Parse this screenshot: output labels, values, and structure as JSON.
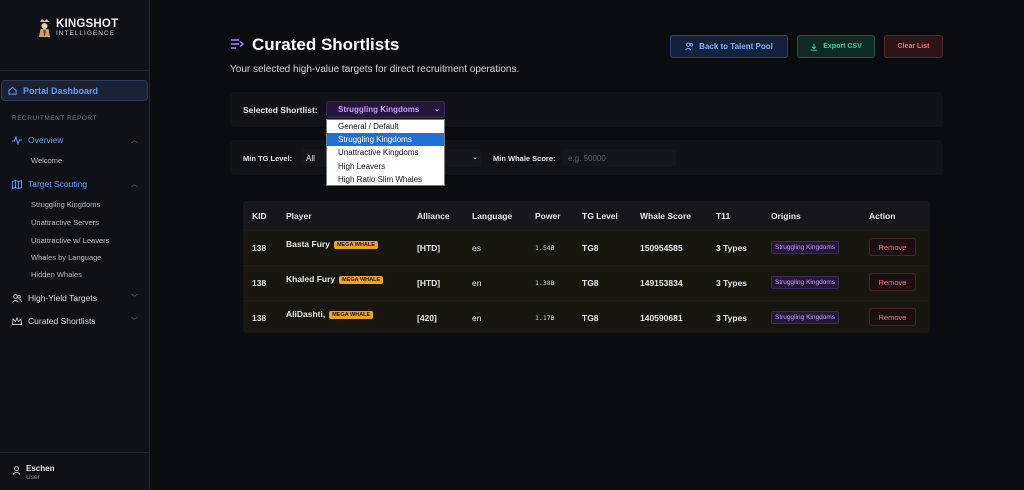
{
  "brand": {
    "title": "KINGSHOT",
    "subtitle": "INTELLIGENCE"
  },
  "sidebar": {
    "portal_label": "Portal Dashboard",
    "section_label": "RECRUITMENT REPORT",
    "overview": {
      "label": "Overview",
      "subitems": [
        "Welcome"
      ]
    },
    "target_scouting": {
      "label": "Target Scouting",
      "subitems": [
        "Struggling Kingdoms",
        "Unattractive Servers",
        "Unattractive w/ Leavers",
        "Whales by Language",
        "Hidden Whales"
      ]
    },
    "high_yield": {
      "label": "High-Yield Targets"
    },
    "curated": {
      "label": "Curated Shortlists"
    },
    "user": {
      "name": "Eschen",
      "role": "User"
    }
  },
  "header": {
    "title": "Curated Shortlists",
    "subtitle": "Your selected high-value targets for direct recruitment operations.",
    "back_label": "Back to Talent Pool",
    "export_label": "Export CSV",
    "clear_label": "Clear List"
  },
  "shortlist": {
    "label": "Selected Shortlist:",
    "selected": "Struggling Kingdoms",
    "options": [
      "General / Default",
      "Struggling Kingdoms",
      "Unattractive Kingdoms",
      "High Leavers",
      "High Ratio Slim Whales"
    ]
  },
  "filters": {
    "min_tg_label": "Min TG Level:",
    "min_tg_value": "All",
    "min_whale_label": "Min Whale Score:",
    "min_whale_placeholder": "e.g. 50000"
  },
  "table": {
    "headers": [
      "KID",
      "Player",
      "Alliance",
      "Language",
      "Power",
      "TG Level",
      "Whale Score",
      "T11",
      "Origins",
      "Action"
    ],
    "rows": [
      {
        "kid": "138",
        "player": "Basta Fury",
        "badge": "MEGA WHALE",
        "alliance": "[HTD]",
        "language": "es",
        "power": "1.54B",
        "tg": "TG8",
        "whale": "150954585",
        "t11": "3 Types",
        "origin": "Struggling Kingdoms",
        "action": "Remove"
      },
      {
        "kid": "138",
        "player": "Khaled Fury",
        "badge": "MEGA WHALE",
        "alliance": "[HTD]",
        "language": "en",
        "power": "1.38B",
        "tg": "TG8",
        "whale": "149153834",
        "t11": "3 Types",
        "origin": "Struggling Kingdoms",
        "action": "Remove"
      },
      {
        "kid": "138",
        "player": "AliDashti,",
        "badge": "MEGA WHALE",
        "alliance": "[420]",
        "language": "en",
        "power": "1.17B",
        "tg": "TG8",
        "whale": "140590681",
        "t11": "3 Types",
        "origin": "Struggling Kingdoms",
        "action": "Remove"
      }
    ]
  }
}
